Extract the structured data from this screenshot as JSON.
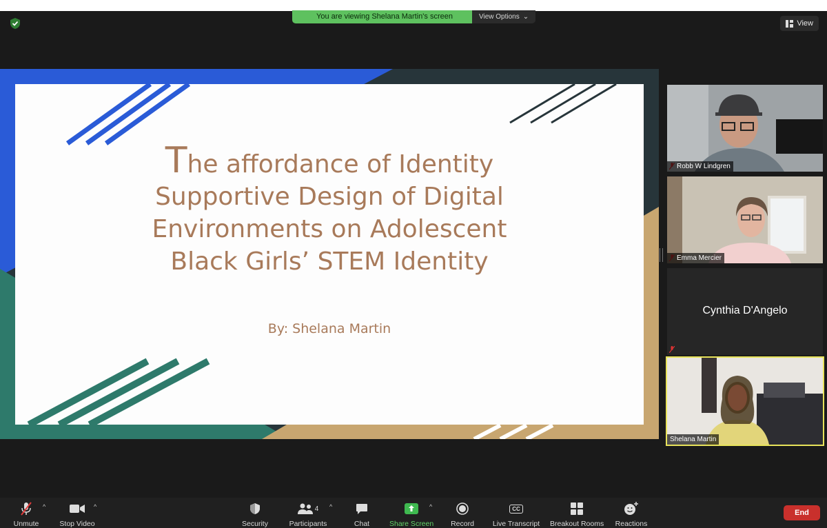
{
  "banner": {
    "text": "You are viewing Shelana Martin's screen",
    "options_label": "View Options"
  },
  "view_button": {
    "label": "View"
  },
  "slide": {
    "title_first_letter": "T",
    "title_rest_line1": "he affordance of Identity",
    "title_line2": "Supportive Design of Digital",
    "title_line3": "Environments on Adolescent",
    "title_line4": "Black Girls’ STEM Identity",
    "subtitle": "By: Shelana Martin"
  },
  "participants": [
    {
      "name": "Robb W Lindgren",
      "muted": true
    },
    {
      "name": "Emma Mercier",
      "muted": true
    },
    {
      "name": "Cynthia D'Angelo",
      "muted": true
    },
    {
      "name": "Shelana Martin",
      "muted": false
    }
  ],
  "toolbar": {
    "unmute": "Unmute",
    "stop_video": "Stop Video",
    "security": "Security",
    "participants": "Participants",
    "participants_count": "4",
    "chat": "Chat",
    "share_screen": "Share Screen",
    "record": "Record",
    "live_transcript": "Live Transcript",
    "breakout_rooms": "Breakout Rooms",
    "reactions": "Reactions",
    "end": "End",
    "cc_badge": "CC"
  },
  "colors": {
    "share_green": "#5ec15f",
    "end_red": "#c9302c",
    "active_speaker": "#e8e35a",
    "slide_text": "#a87a5a"
  }
}
